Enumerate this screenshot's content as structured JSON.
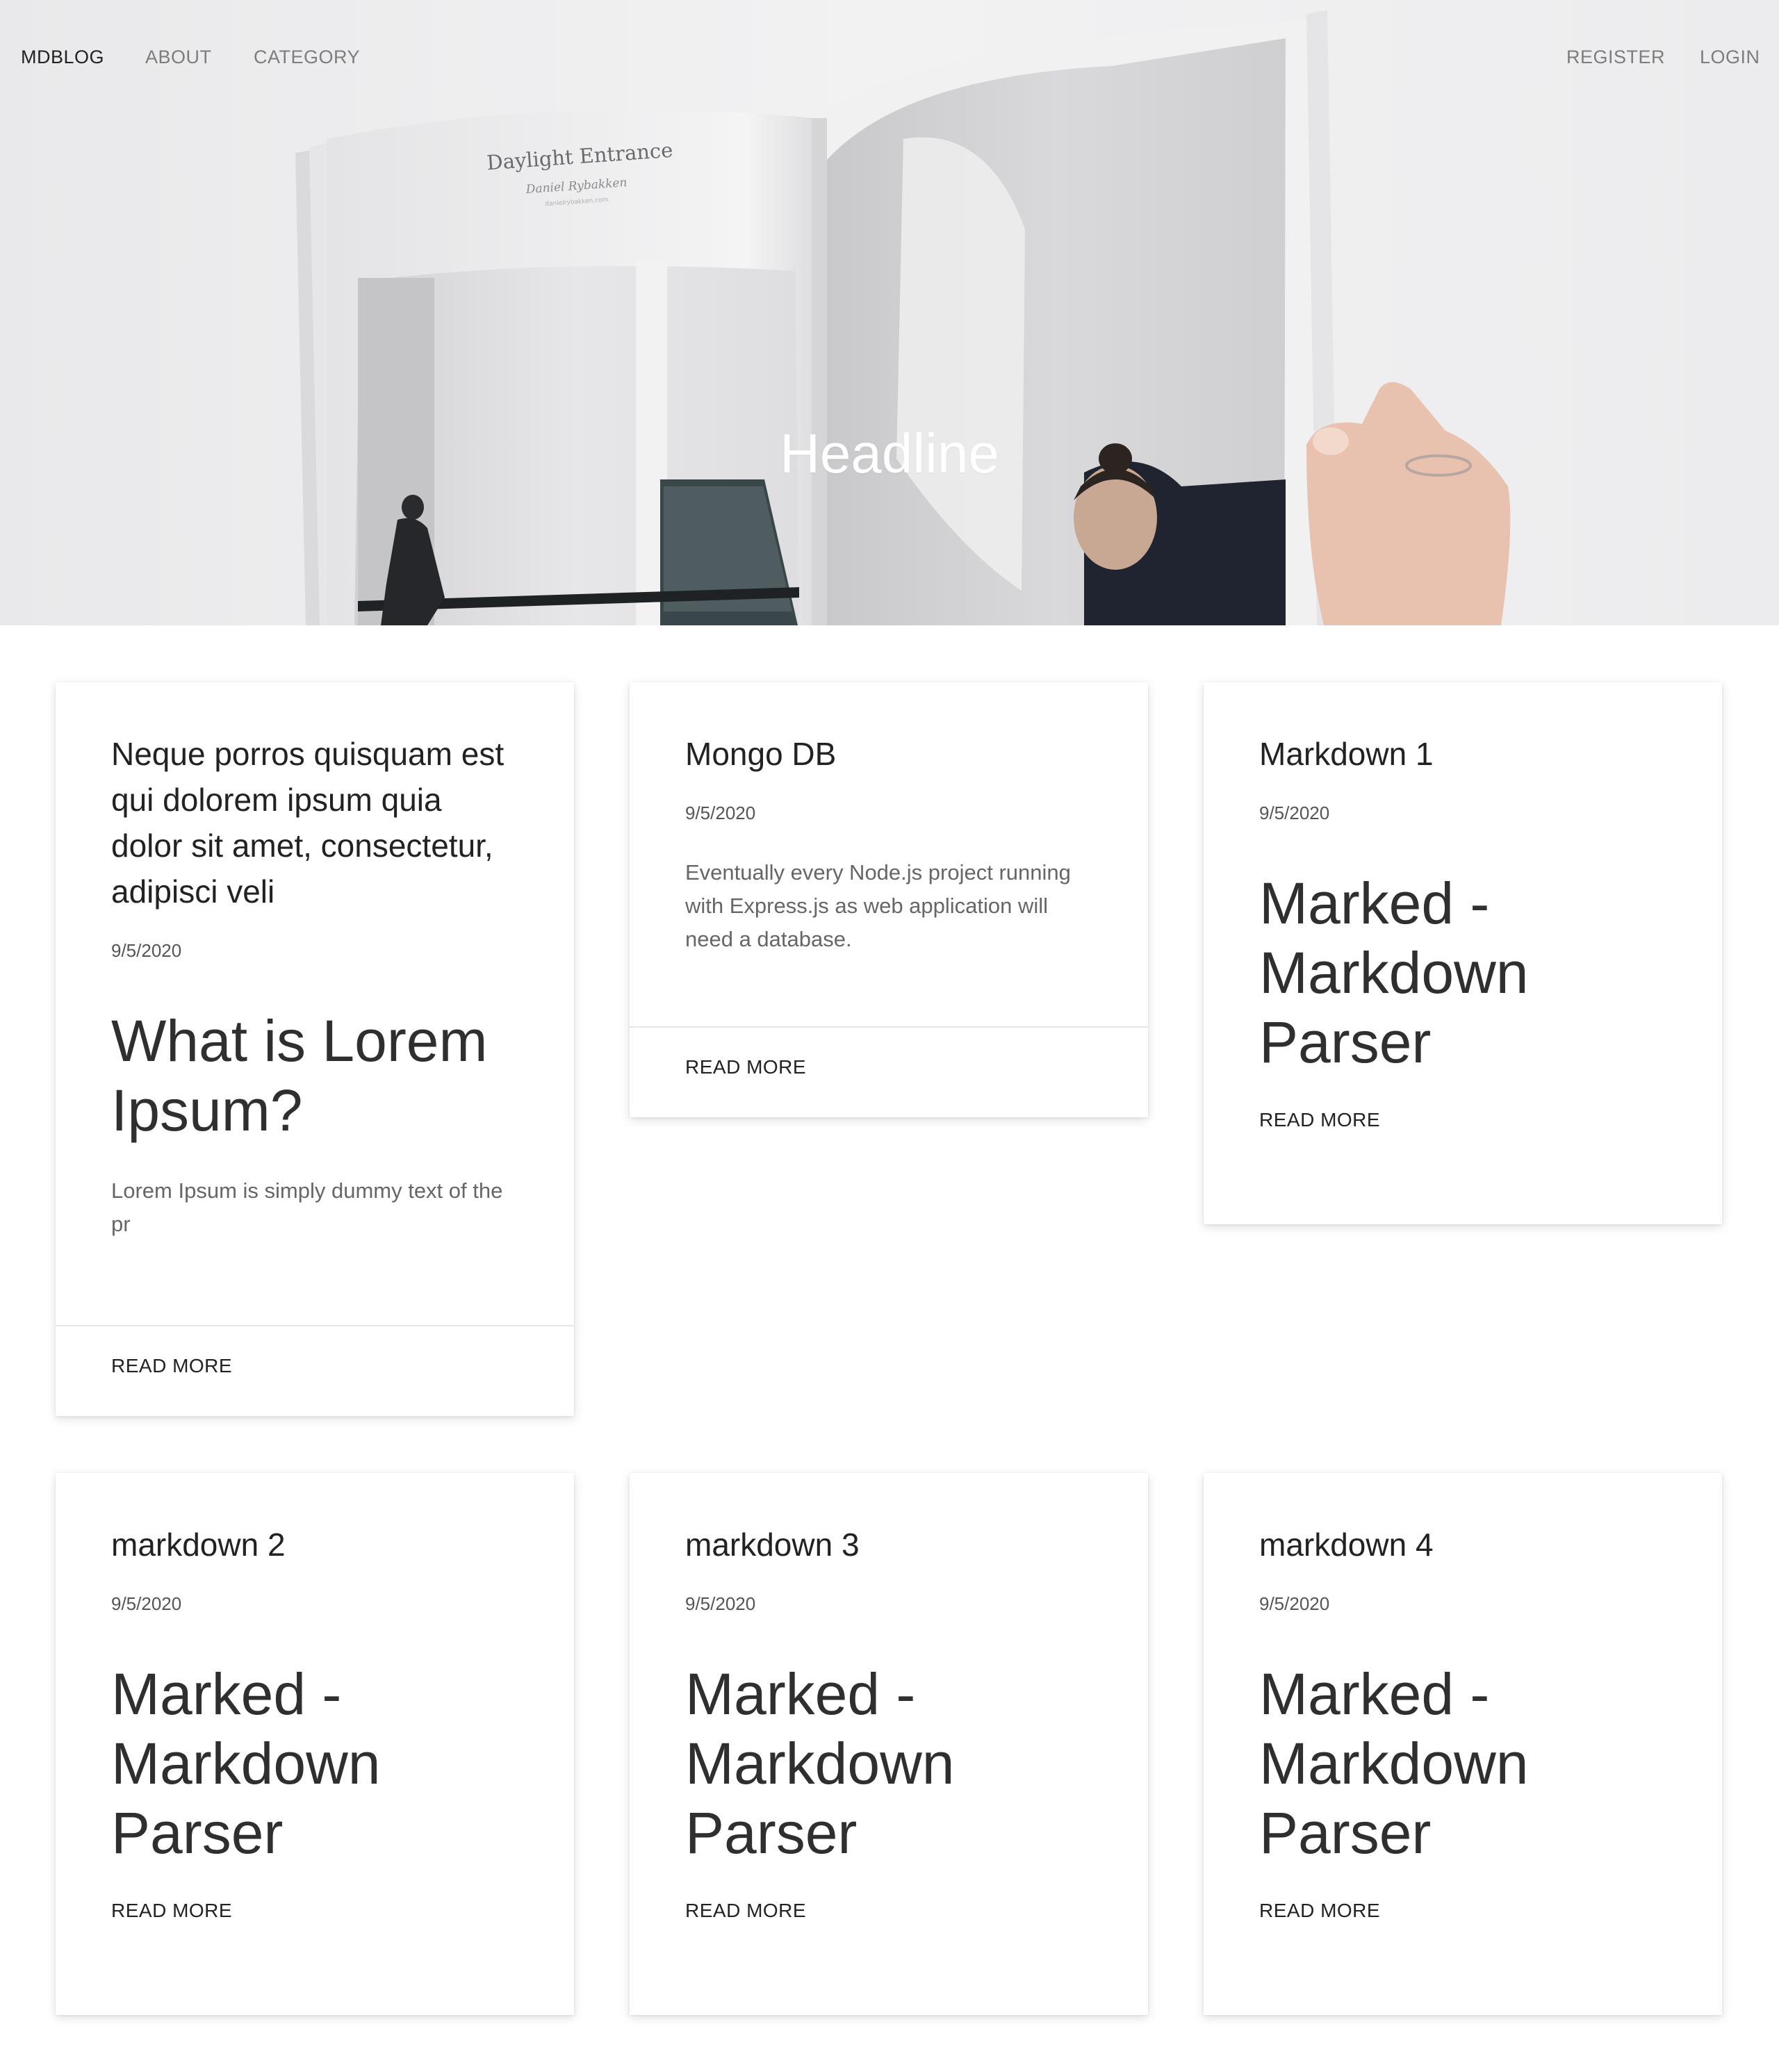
{
  "nav": {
    "brand": "MDBLOG",
    "about": "ABOUT",
    "category": "CATEGORY",
    "register": "REGISTER",
    "login": "LOGIN"
  },
  "hero": {
    "headline": "Headline",
    "book_title": "Daylight Entrance",
    "book_author": "Daniel Rybakken",
    "book_url": "danielrybakken.com"
  },
  "cards": [
    {
      "title": "Neque porros quisquam est qui dolorem ipsum quia dolor sit amet, consectetur, adipisci veli",
      "date": "9/5/2020",
      "heading": "What is Lorem Ipsum?",
      "text": "Lorem Ipsum is simply dummy text of the pr",
      "read_more": "READ MORE"
    },
    {
      "title": "Mongo DB",
      "date": "9/5/2020",
      "text": "Eventually every Node.js project running with Express.js as web application will need a database.",
      "read_more": "READ MORE"
    },
    {
      "title": "Markdown 1",
      "date": "9/5/2020",
      "heading": "Marked - Markdown Parser",
      "read_more": "READ MORE"
    },
    {
      "title": "markdown 2",
      "date": "9/5/2020",
      "heading": "Marked - Markdown Parser",
      "read_more": "READ MORE"
    },
    {
      "title": "markdown 3",
      "date": "9/5/2020",
      "heading": "Marked - Markdown Parser",
      "read_more": "READ MORE"
    },
    {
      "title": "markdown 4",
      "date": "9/5/2020",
      "heading": "Marked - Markdown Parser",
      "read_more": "READ MORE"
    }
  ]
}
